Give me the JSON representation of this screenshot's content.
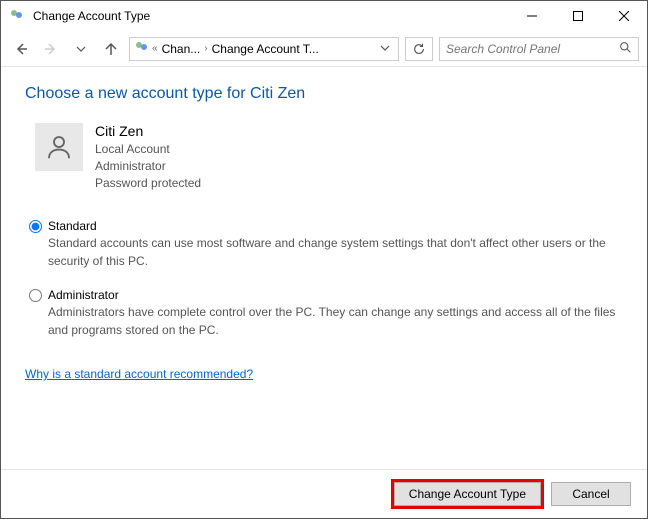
{
  "window": {
    "title": "Change Account Type"
  },
  "breadcrumb": {
    "crumb1": "Chan...",
    "crumb2": "Change Account T..."
  },
  "search": {
    "placeholder": "Search Control Panel"
  },
  "page": {
    "heading": "Choose a new account type for Citi Zen"
  },
  "account": {
    "name": "Citi Zen",
    "line1": "Local Account",
    "line2": "Administrator",
    "line3": "Password protected"
  },
  "options": {
    "standard": {
      "label": "Standard",
      "desc": "Standard accounts can use most software and change system settings that don't affect other users or the security of this PC."
    },
    "administrator": {
      "label": "Administrator",
      "desc": "Administrators have complete control over the PC. They can change any settings and access all of the files and programs stored on the PC."
    }
  },
  "help_link": "Why is a standard account recommended?",
  "footer": {
    "change": "Change Account Type",
    "cancel": "Cancel"
  }
}
